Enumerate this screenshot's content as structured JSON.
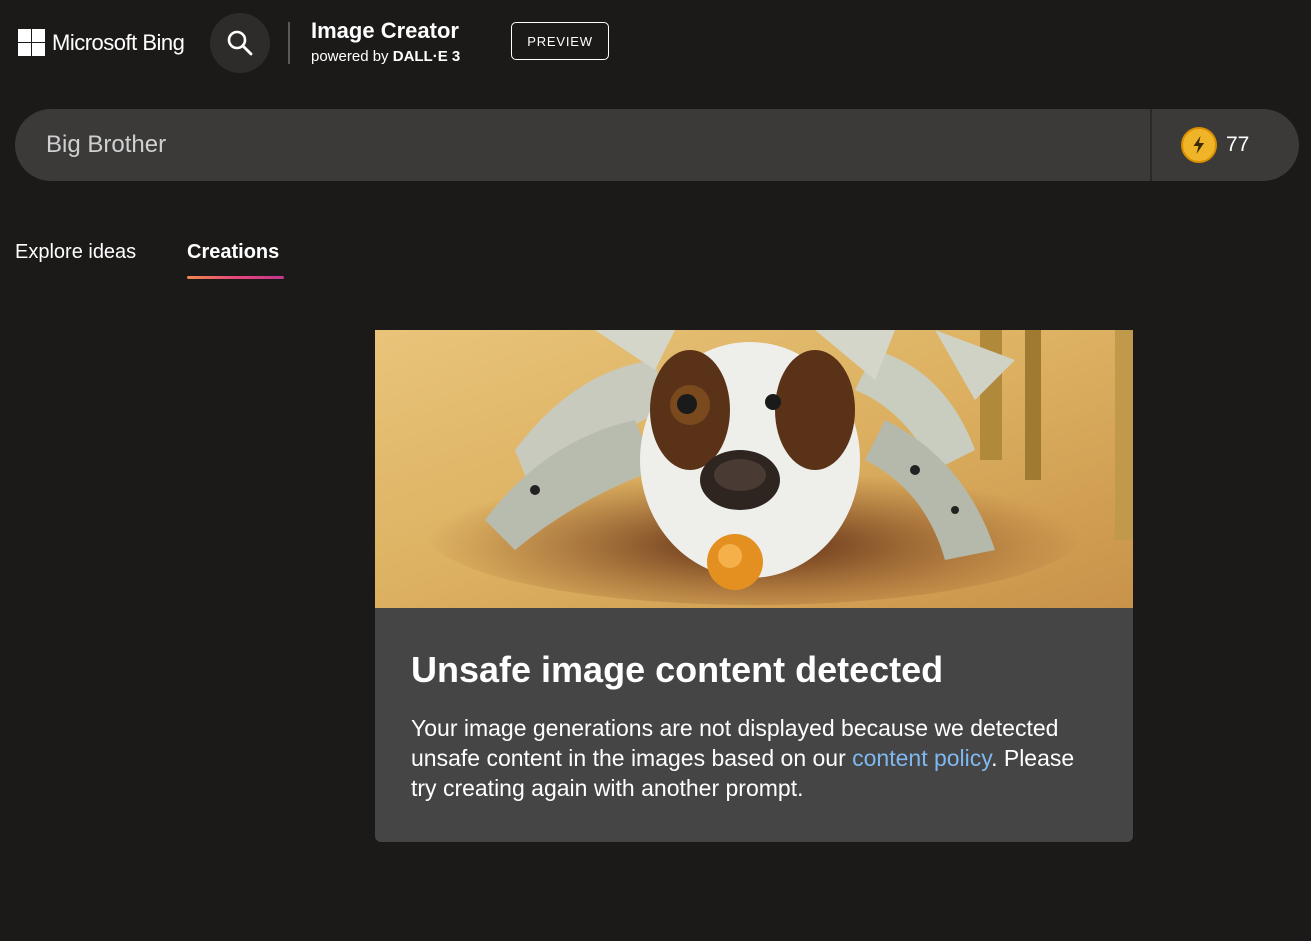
{
  "header": {
    "brand": "Microsoft Bing",
    "app_title": "Image Creator",
    "powered_by_prefix": "powered by",
    "powered_by_model": "DALL·E 3",
    "preview_badge": "PREVIEW"
  },
  "prompt": {
    "value": "Big Brother",
    "boosts_count": "77"
  },
  "tabs": [
    {
      "label": "Explore ideas",
      "selected": false
    },
    {
      "label": "Creations",
      "selected": true
    }
  ],
  "result_card": {
    "title": "Unsafe image content detected",
    "message_before_link": "Your image generations are not displayed because we detected unsafe content in the images based on our ",
    "link_text": "content policy",
    "message_after_link": ". Please try creating again with another prompt."
  },
  "colors": {
    "background": "#1b1a19",
    "bar": "#3b3a39",
    "card": "#454545",
    "link": "#7fb8f0",
    "boost_coin": "#f0b429"
  },
  "icons": {
    "logo": "microsoft-logo-icon",
    "search": "search-icon",
    "boost": "lightning-bolt-icon"
  }
}
